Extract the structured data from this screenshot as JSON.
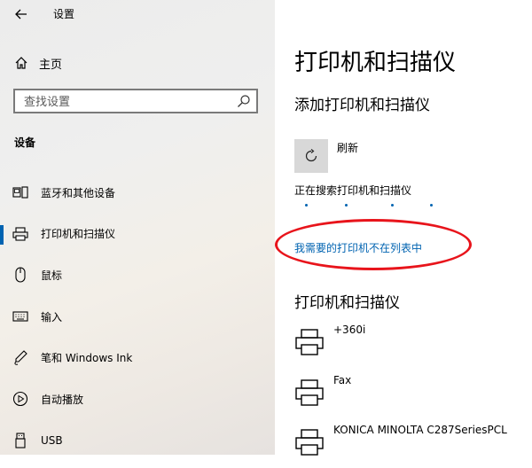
{
  "window": {
    "title": "设置",
    "back_icon": "arrow-left-icon"
  },
  "sidebar": {
    "home_label": "主页",
    "search_placeholder": "查找设置",
    "section_label": "设备",
    "items": [
      {
        "label": "蓝牙和其他设备",
        "icon": "bluetooth-devices-icon",
        "active": false
      },
      {
        "label": "打印机和扫描仪",
        "icon": "printer-icon",
        "active": true
      },
      {
        "label": "鼠标",
        "icon": "mouse-icon",
        "active": false
      },
      {
        "label": "输入",
        "icon": "keyboard-icon",
        "active": false
      },
      {
        "label": "笔和 Windows Ink",
        "icon": "pen-icon",
        "active": false
      },
      {
        "label": "自动播放",
        "icon": "autoplay-icon",
        "active": false
      },
      {
        "label": "USB",
        "icon": "usb-icon",
        "active": false
      }
    ]
  },
  "main": {
    "title": "打印机和扫描仪",
    "add_section_title": "添加打印机和扫描仪",
    "refresh_label": "刷新",
    "searching_text": "正在搜索打印机和扫描仪",
    "not_listed_link": "我需要的打印机不在列表中",
    "printers_section_title": "打印机和扫描仪",
    "printers": [
      {
        "name": "+360i"
      },
      {
        "name": "Fax"
      },
      {
        "name": "KONICA MINOLTA C287SeriesPCL"
      }
    ]
  },
  "colors": {
    "accent": "#0063b1",
    "highlight_ellipse": "#e8141b"
  }
}
